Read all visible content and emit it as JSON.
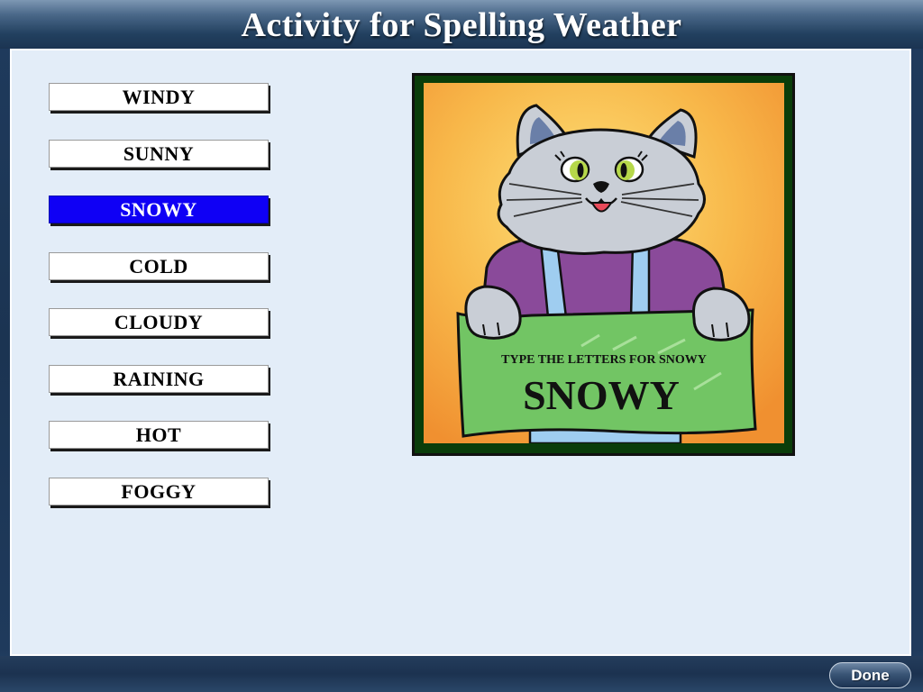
{
  "window": {
    "title": "Activity for Spelling Weather"
  },
  "word_list": {
    "items": [
      {
        "label": "WINDY",
        "selected": false
      },
      {
        "label": "SUNNY",
        "selected": false
      },
      {
        "label": "SNOWY",
        "selected": true
      },
      {
        "label": "COLD",
        "selected": false
      },
      {
        "label": "CLOUDY",
        "selected": false
      },
      {
        "label": "RAINING",
        "selected": false
      },
      {
        "label": "HOT",
        "selected": false
      },
      {
        "label": "FOGGY",
        "selected": false
      }
    ]
  },
  "picture": {
    "sign_instruction": "TYPE THE LETTERS FOR SNOWY",
    "sign_word": "SNOWY"
  },
  "footer": {
    "done_label": "Done"
  },
  "colors": {
    "selected_bg": "#0f00f5",
    "content_bg": "#e3edf8",
    "frame_green": "#0a3d0a",
    "sign_green": "#72c564"
  }
}
